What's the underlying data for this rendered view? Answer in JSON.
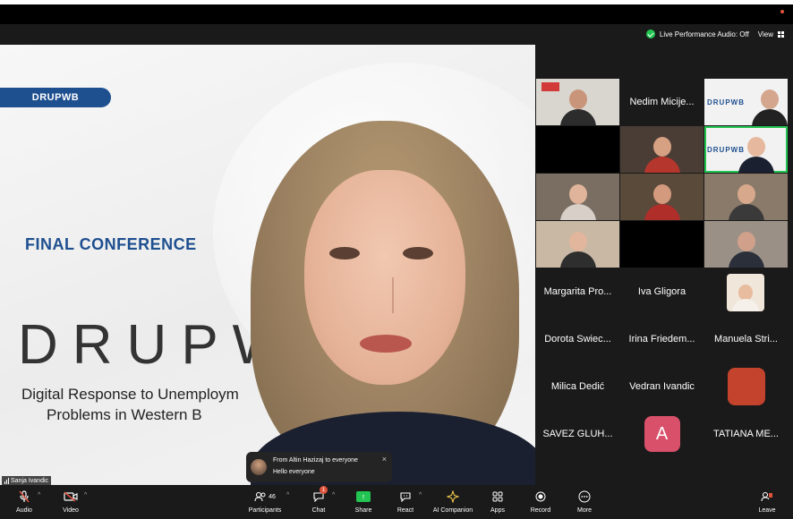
{
  "status": {
    "live_audio": "Live Performance Audio: Off",
    "view": "View"
  },
  "stage": {
    "pill": "DRUPWB",
    "final_conference": "FINAL CONFERENCE",
    "big_title": "DRUPWI",
    "line1": "Digital Response to Unemploym",
    "line2": "Problems in Western B",
    "speaker_name": "Sanja Ivandic"
  },
  "gallery": {
    "nedim": "Nedim Micije...",
    "mini_slide_label": "DRUPWB",
    "mini_slide_label2": "DRUPWB",
    "margarita": "Margarita Pro...",
    "iva": "Iva Gligora",
    "dorota": "Dorota Swiec...",
    "irina": "Irina Friedem...",
    "manuela": "Manuela Stri...",
    "milica": "Milica Dedić",
    "vedran": "Vedran Ivandic",
    "savez": "SAVEZ GLUH...",
    "avatar_letter": "A",
    "tatiana": "TATIANA ME..."
  },
  "chat_toast": {
    "from": "From Altin Hazizaj to everyone",
    "message": "Hello everyone",
    "close": "×"
  },
  "toolbar": {
    "audio": "Audio",
    "video": "Video",
    "participants": "Participants",
    "participants_count": "46",
    "chat": "Chat",
    "chat_badge": "1",
    "share": "Share",
    "react": "React",
    "ai_companion": "AI Companion",
    "apps": "Apps",
    "record": "Record",
    "more": "More",
    "leave": "Leave"
  },
  "colors": {
    "accent_green": "#23c552",
    "brand_blue": "#1e4f8f",
    "alert_red": "#e0533d",
    "avatar_pink": "#d9506b",
    "tile_orange": "#c4432c"
  }
}
